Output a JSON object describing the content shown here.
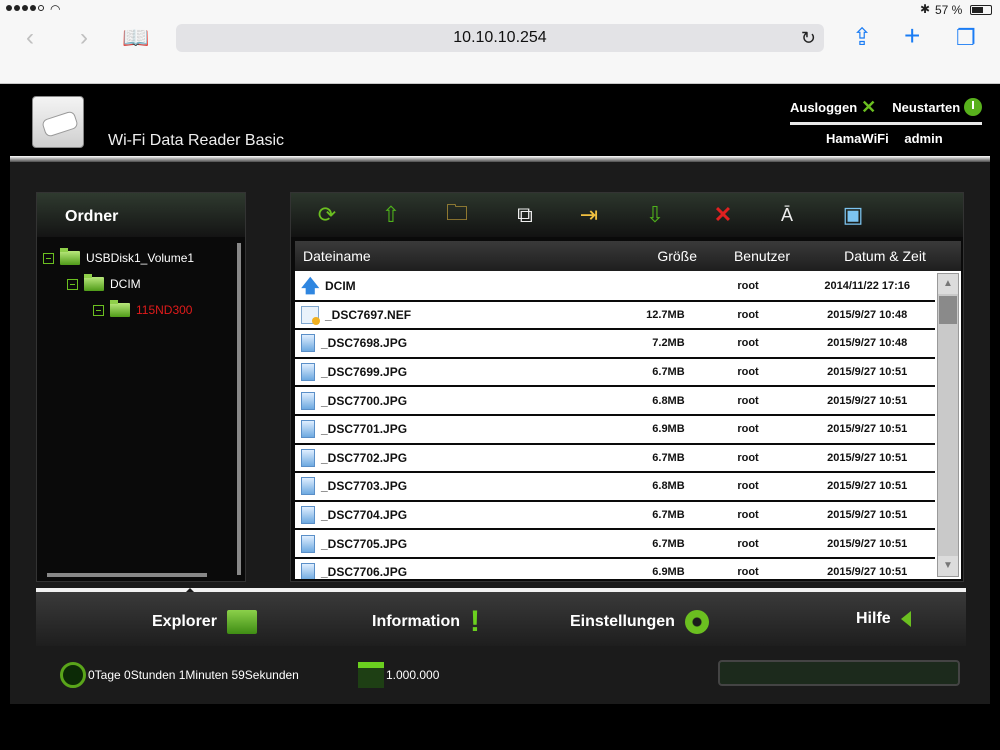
{
  "status": {
    "battery": "57 %"
  },
  "browser": {
    "url": "10.10.10.254"
  },
  "header": {
    "product": "Wi-Fi Data Reader Basic",
    "logout": "Ausloggen",
    "restart": "Neustarten",
    "ssid": "HamaWiFi",
    "user": "admin"
  },
  "folders": {
    "title": "Ordner",
    "tree": [
      "USBDisk1_Volume1",
      "DCIM",
      "115ND300"
    ]
  },
  "files": {
    "columns": {
      "name": "Dateiname",
      "size": "Größe",
      "user": "Benutzer",
      "date": "Datum & Zeit"
    },
    "rows": [
      {
        "name": "DCIM",
        "size": "",
        "user": "root",
        "date": "2014/11/22 17:16"
      },
      {
        "name": "_DSC7697.NEF",
        "size": "12.7MB",
        "user": "root",
        "date": "2015/9/27 10:48"
      },
      {
        "name": "_DSC7698.JPG",
        "size": "7.2MB",
        "user": "root",
        "date": "2015/9/27 10:48"
      },
      {
        "name": "_DSC7699.JPG",
        "size": "6.7MB",
        "user": "root",
        "date": "2015/9/27 10:51"
      },
      {
        "name": "_DSC7700.JPG",
        "size": "6.8MB",
        "user": "root",
        "date": "2015/9/27 10:51"
      },
      {
        "name": "_DSC7701.JPG",
        "size": "6.9MB",
        "user": "root",
        "date": "2015/9/27 10:51"
      },
      {
        "name": "_DSC7702.JPG",
        "size": "6.7MB",
        "user": "root",
        "date": "2015/9/27 10:51"
      },
      {
        "name": "_DSC7703.JPG",
        "size": "6.8MB",
        "user": "root",
        "date": "2015/9/27 10:51"
      },
      {
        "name": "_DSC7704.JPG",
        "size": "6.7MB",
        "user": "root",
        "date": "2015/9/27 10:51"
      },
      {
        "name": "_DSC7705.JPG",
        "size": "6.7MB",
        "user": "root",
        "date": "2015/9/27 10:51"
      },
      {
        "name": "_DSC7706.JPG",
        "size": "6.9MB",
        "user": "root",
        "date": "2015/9/27 10:51"
      }
    ]
  },
  "nav": {
    "explorer": "Explorer",
    "information": "Information",
    "settings": "Einstellungen",
    "help": "Hilfe"
  },
  "footer": {
    "uptime": "0Tage 0Stunden 1Minuten 59Sekunden",
    "count": "1.000.000"
  },
  "colors": {
    "accent": "#6bbf20",
    "error": "#e01b1b",
    "link": "#1a7cf4"
  }
}
